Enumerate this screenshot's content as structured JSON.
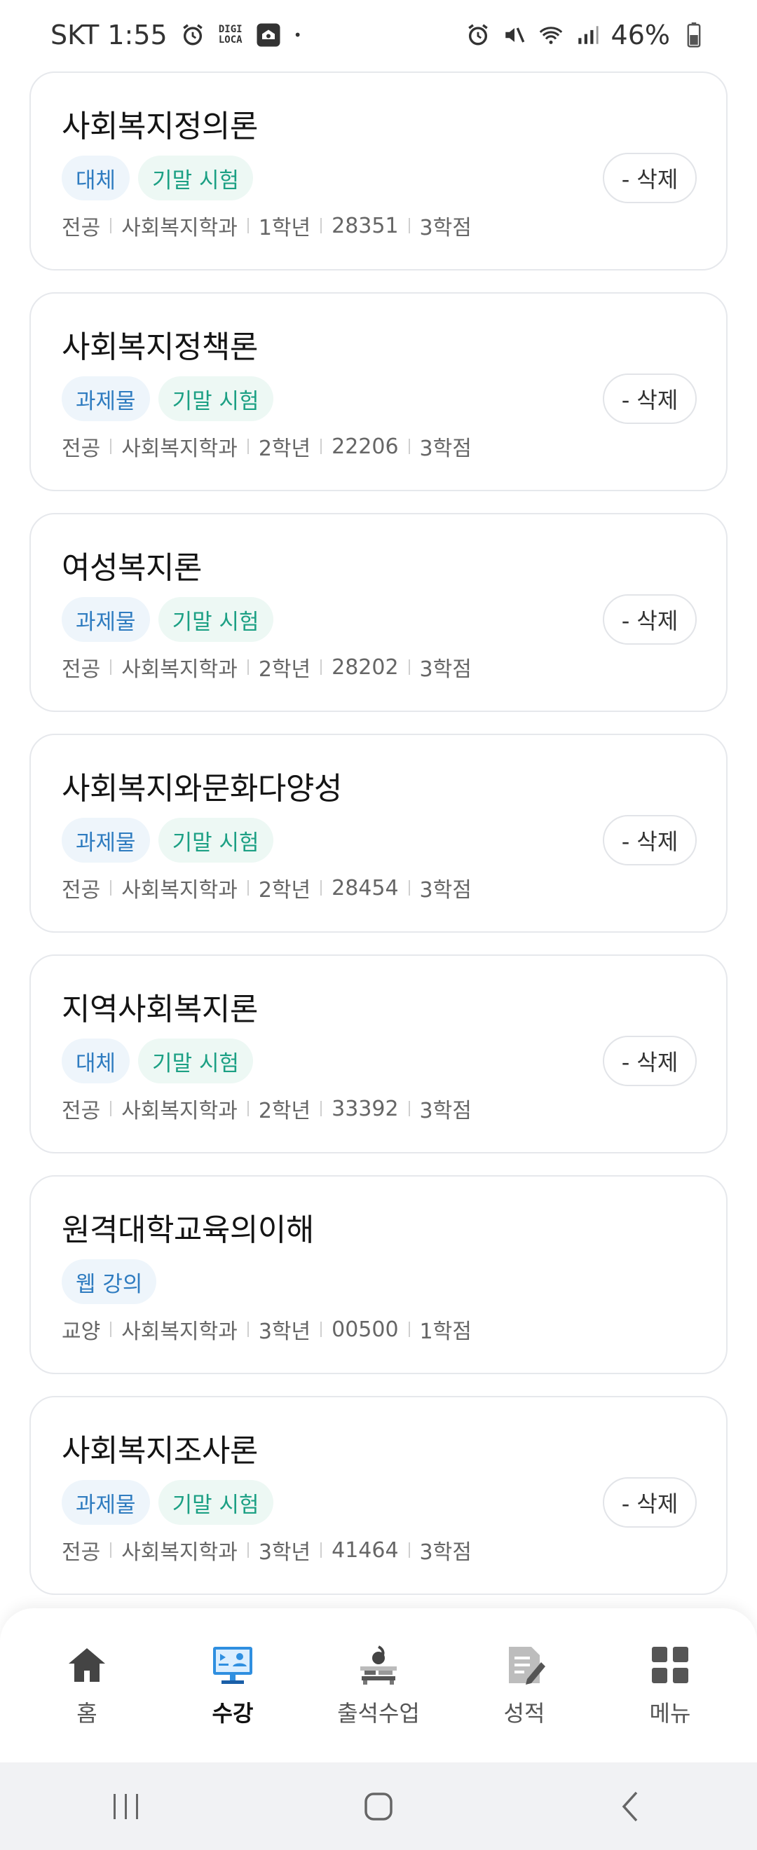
{
  "status_bar": {
    "carrier_time": "SKT 1:55",
    "digi_line1": "DIGI",
    "digi_line2": "LOCA",
    "dot": "•",
    "battery": "46%"
  },
  "courses": [
    {
      "title": "사회복지정의론",
      "tags": [
        {
          "text": "대체",
          "color": "blue"
        },
        {
          "text": "기말 시험",
          "color": "green"
        }
      ],
      "type": "전공",
      "dept": "사회복지학과",
      "year": "1학년",
      "code": "28351",
      "credits": "3학점",
      "delete_label": "- 삭제"
    },
    {
      "title": "사회복지정책론",
      "tags": [
        {
          "text": "과제물",
          "color": "blue"
        },
        {
          "text": "기말 시험",
          "color": "green"
        }
      ],
      "type": "전공",
      "dept": "사회복지학과",
      "year": "2학년",
      "code": "22206",
      "credits": "3학점",
      "delete_label": "- 삭제"
    },
    {
      "title": "여성복지론",
      "tags": [
        {
          "text": "과제물",
          "color": "blue"
        },
        {
          "text": "기말 시험",
          "color": "green"
        }
      ],
      "type": "전공",
      "dept": "사회복지학과",
      "year": "2학년",
      "code": "28202",
      "credits": "3학점",
      "delete_label": "- 삭제"
    },
    {
      "title": "사회복지와문화다양성",
      "tags": [
        {
          "text": "과제물",
          "color": "blue"
        },
        {
          "text": "기말 시험",
          "color": "green"
        }
      ],
      "type": "전공",
      "dept": "사회복지학과",
      "year": "2학년",
      "code": "28454",
      "credits": "3학점",
      "delete_label": "- 삭제"
    },
    {
      "title": "지역사회복지론",
      "tags": [
        {
          "text": "대체",
          "color": "blue"
        },
        {
          "text": "기말 시험",
          "color": "green"
        }
      ],
      "type": "전공",
      "dept": "사회복지학과",
      "year": "2학년",
      "code": "33392",
      "credits": "3학점",
      "delete_label": "- 삭제"
    },
    {
      "title": "원격대학교육의이해",
      "tags": [
        {
          "text": "웹 강의",
          "color": "blue"
        }
      ],
      "type": "교양",
      "dept": "사회복지학과",
      "year": "3학년",
      "code": "00500",
      "credits": "1학점",
      "delete_label": ""
    },
    {
      "title": "사회복지조사론",
      "tags": [
        {
          "text": "과제물",
          "color": "blue"
        },
        {
          "text": "기말 시험",
          "color": "green"
        }
      ],
      "type": "전공",
      "dept": "사회복지학과",
      "year": "3학년",
      "code": "41464",
      "credits": "3학점",
      "delete_label": "- 삭제"
    }
  ],
  "bottom_nav": [
    {
      "label": "홈",
      "icon": "home-icon",
      "active": false
    },
    {
      "label": "수강",
      "icon": "lecture-monitor-icon",
      "active": true
    },
    {
      "label": "출석수업",
      "icon": "attendance-class-icon",
      "active": false
    },
    {
      "label": "성적",
      "icon": "grades-document-icon",
      "active": false
    },
    {
      "label": "메뉴",
      "icon": "menu-grid-icon",
      "active": false
    }
  ],
  "colors": {
    "tag_blue_text": "#2f7cc0",
    "tag_blue_bg": "#eef5fb",
    "tag_green_text": "#1ca084",
    "tag_green_bg": "#edf8f4",
    "active_icon_blue": "#2f8fe0"
  }
}
